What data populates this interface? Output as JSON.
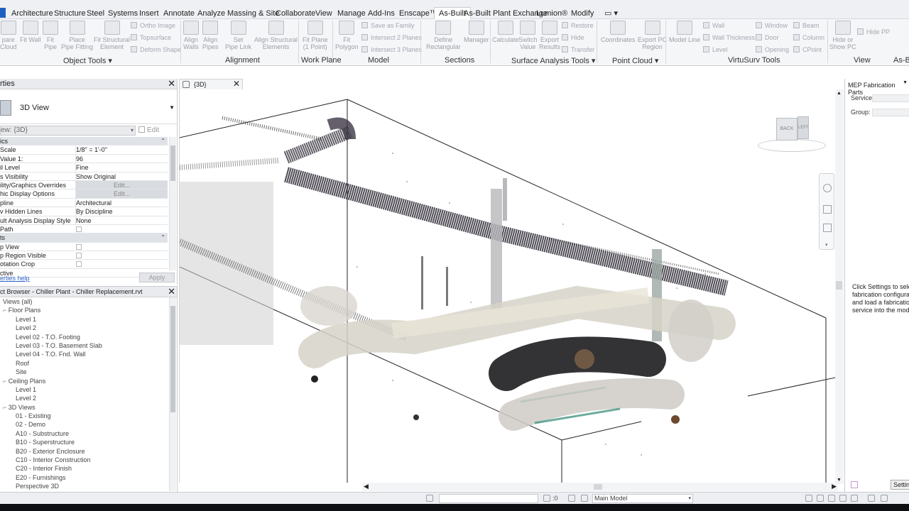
{
  "ribbon_tabs": [
    "Architecture",
    "Structure",
    "Steel",
    "Systems",
    "Insert",
    "Annotate",
    "Analyze",
    "Massing & Site",
    "Collaborate",
    "View",
    "Manage",
    "Add-Ins",
    "Enscape™",
    "As-Built",
    "As-Built Plant Exchange",
    "Lumion®",
    "Modify"
  ],
  "active_tab": "As-Built",
  "ribbon": {
    "object_tools": {
      "title": "Object Tools",
      "cmds": [
        "pare\nCloud",
        "Fit Wall",
        "Fit\nPipe",
        "Place\nPipe Fitting",
        "Fit Structural\nElement"
      ],
      "minis": [
        "Ortho Image",
        "Topsurface",
        "Deform Shape"
      ]
    },
    "alignment": {
      "title": "Alignment",
      "cmds": [
        "Align\nWalls",
        "Align\nPipes",
        "Set\nPipe Link",
        "Align Structural\nElements"
      ]
    },
    "work_plane": {
      "title": "Work Plane",
      "cmds": [
        "Fit Plane\n(1 Point)"
      ]
    },
    "model": {
      "title": "Model",
      "cmds": [
        "Fit\nPolygon"
      ],
      "minis": [
        "Save as Family",
        "Intersect 2 Planes",
        "Intersect 3 Planes"
      ]
    },
    "sections": {
      "title": "Sections",
      "cmds": [
        "Define\nRectangular",
        "Manager"
      ]
    },
    "surface_analysis": {
      "title": "Surface Analysis Tools",
      "cmds": [
        "Calculate",
        "Switch\nValue",
        "Export\nResults"
      ],
      "minis": [
        "Restore",
        "Hide",
        "Transfer"
      ]
    },
    "point_cloud": {
      "title": "Point Cloud",
      "cmds": [
        "Coordinates",
        "Export PC\nRegion"
      ]
    },
    "virtusurv": {
      "title": "VirtuSurv Tools",
      "cmds": [
        "Model Line"
      ],
      "minis": [
        "Wall",
        "Wall Thickness",
        "Level",
        "Window",
        "Door",
        "Opening",
        "Beam",
        "Column",
        "CPoint"
      ]
    },
    "view": {
      "title": "View",
      "cmds": [
        "Hide or\nShow PC"
      ],
      "minis": [
        "Hide PP"
      ]
    },
    "as_b": "As-B"
  },
  "properties": {
    "title": "rties",
    "type_name": "3D View",
    "instance_selector": "ew: {3D}",
    "edit_type": "Edit Type",
    "rows": [
      {
        "k": "ics",
        "v": "",
        "group": true
      },
      {
        "k": "Scale",
        "v": "1/8\" = 1'-0\""
      },
      {
        "k": "Value    1:",
        "v": "96"
      },
      {
        "k": "il Level",
        "v": "Fine"
      },
      {
        "k": "s Visibility",
        "v": "Show Original"
      },
      {
        "k": "ility/Graphics Overrides",
        "v": "Edit...",
        "btn": true
      },
      {
        "k": "hic Display Options",
        "v": "Edit...",
        "btn": true
      },
      {
        "k": "pline",
        "v": "Architectural"
      },
      {
        "k": "v Hidden Lines",
        "v": "By Discipline"
      },
      {
        "k": "ult Analysis Display Style",
        "v": "None"
      },
      {
        "k": "Path",
        "v": "",
        "chk": true
      },
      {
        "k": "ts",
        "v": "",
        "group": true
      },
      {
        "k": "p View",
        "v": "",
        "chk": true
      },
      {
        "k": "p Region Visible",
        "v": "",
        "chk": true
      },
      {
        "k": "otation Crop",
        "v": "",
        "chk": true
      },
      {
        "k": "ctive",
        "v": ""
      }
    ],
    "help_link": "erties help",
    "apply": "Apply"
  },
  "browser": {
    "title": "ct Browser - Chiller Plant - Chiller Replacement.rvt",
    "nodes": [
      {
        "label": "Views (all)",
        "indent": 0
      },
      {
        "label": "Floor Plans",
        "indent": 1
      },
      {
        "label": "Level 1",
        "indent": 2
      },
      {
        "label": "Level 2",
        "indent": 2
      },
      {
        "label": "Level 02 - T.O. Footing",
        "indent": 2
      },
      {
        "label": "Level 03 - T.O. Basement Slab",
        "indent": 2
      },
      {
        "label": "Level 04 - T.O. Fnd. Wall",
        "indent": 2
      },
      {
        "label": "Roof",
        "indent": 2
      },
      {
        "label": "Site",
        "indent": 2
      },
      {
        "label": "Ceiling Plans",
        "indent": 1
      },
      {
        "label": "Level 1",
        "indent": 2
      },
      {
        "label": "Level 2",
        "indent": 2
      },
      {
        "label": "3D Views",
        "indent": 1
      },
      {
        "label": "01 - Existing",
        "indent": 2
      },
      {
        "label": "02 - Demo",
        "indent": 2
      },
      {
        "label": "A10 - Substructure",
        "indent": 2
      },
      {
        "label": "B10 - Superstructure",
        "indent": 2
      },
      {
        "label": "B20 - Exterior Enclosure",
        "indent": 2
      },
      {
        "label": "C10 - Interior Construction",
        "indent": 2
      },
      {
        "label": "C20 - Interior Finish",
        "indent": 2
      },
      {
        "label": "E20 - Furnishings",
        "indent": 2
      },
      {
        "label": "Perspective 3D",
        "indent": 2
      }
    ]
  },
  "view_tab": "{3D}",
  "viewcube": {
    "back": "BACK",
    "left": "LEFT"
  },
  "mep": {
    "title": "MEP Fabrication Parts",
    "service_label": "Service:",
    "group_label": "Group:",
    "message": [
      "Click Settings to select",
      "fabrication configurati",
      "and load a fabrication",
      "service into the model"
    ],
    "settings": "Setting"
  },
  "status": {
    "model": "Main Model",
    "zero": ":0"
  }
}
